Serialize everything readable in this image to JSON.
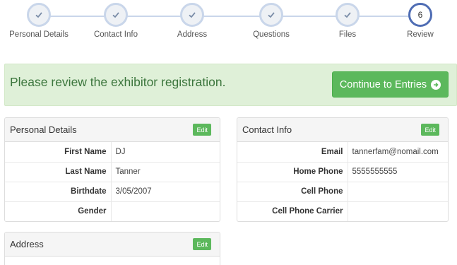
{
  "stepper": {
    "steps": [
      {
        "label": "Personal Details",
        "state": "done"
      },
      {
        "label": "Contact Info",
        "state": "done"
      },
      {
        "label": "Address",
        "state": "done"
      },
      {
        "label": "Questions",
        "state": "done"
      },
      {
        "label": "Files",
        "state": "done"
      },
      {
        "label": "Review",
        "state": "active",
        "number": "6"
      }
    ]
  },
  "alert": {
    "message": "Please review the exhibitor registration.",
    "continue_label": "Continue to Entries",
    "continue_icon": "arrow-circle-right-icon"
  },
  "personal": {
    "title": "Personal Details",
    "edit_label": "Edit",
    "rows": [
      {
        "key": "First Name",
        "value": "DJ"
      },
      {
        "key": "Last Name",
        "value": "Tanner"
      },
      {
        "key": "Birthdate",
        "value": "3/05/2007"
      },
      {
        "key": "Gender",
        "value": ""
      }
    ]
  },
  "contact": {
    "title": "Contact Info",
    "edit_label": "Edit",
    "rows": [
      {
        "key": "Email",
        "value": "tannerfam@nomail.com"
      },
      {
        "key": "Home Phone",
        "value": "5555555555"
      },
      {
        "key": "Cell Phone",
        "value": ""
      },
      {
        "key": "Cell Phone Carrier",
        "value": ""
      }
    ]
  },
  "address": {
    "title": "Address",
    "edit_label": "Edit"
  },
  "colors": {
    "success": "#5cb85c",
    "alert_bg": "#dff0d8",
    "alert_text": "#3c763d",
    "step_done": "#c9d6ea",
    "step_active": "#4f6db4"
  }
}
